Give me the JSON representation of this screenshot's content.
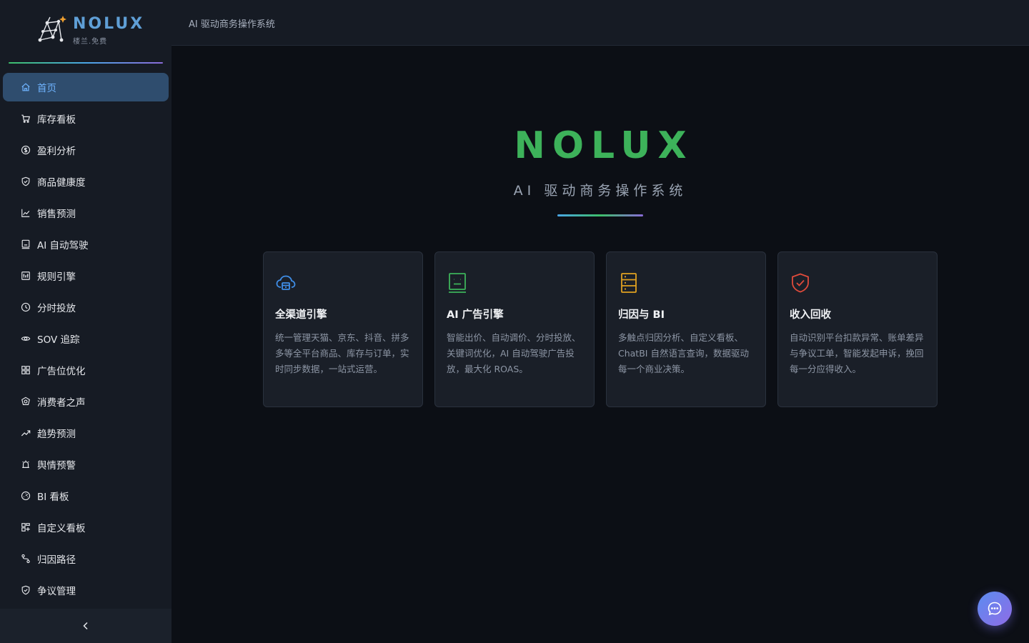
{
  "brand": {
    "name": "NOLUX",
    "subtitle": "楼兰.免费"
  },
  "topbar": {
    "title": "AI 驱动商务操作系统"
  },
  "sidebar": {
    "items": [
      {
        "label": "首页",
        "icon": "home-icon",
        "active": true
      },
      {
        "label": "库存看板",
        "icon": "cart-icon"
      },
      {
        "label": "盈利分析",
        "icon": "dollar-circle-icon"
      },
      {
        "label": "商品健康度",
        "icon": "shield-check-icon"
      },
      {
        "label": "销售预测",
        "icon": "line-chart-icon"
      },
      {
        "label": "AI 自动驾驶",
        "icon": "robot-icon"
      },
      {
        "label": "规则引擎",
        "icon": "rules-icon"
      },
      {
        "label": "分时投放",
        "icon": "clock-icon"
      },
      {
        "label": "SOV 追踪",
        "icon": "eye-icon"
      },
      {
        "label": "广告位优化",
        "icon": "grid-icon"
      },
      {
        "label": "消费者之声",
        "icon": "voice-icon"
      },
      {
        "label": "趋势预测",
        "icon": "trend-icon"
      },
      {
        "label": "舆情预警",
        "icon": "alert-bell-icon"
      },
      {
        "label": "BI 看板",
        "icon": "dashboard-icon"
      },
      {
        "label": "自定义看板",
        "icon": "custom-board-icon"
      },
      {
        "label": "归因路径",
        "icon": "path-icon"
      },
      {
        "label": "争议管理",
        "icon": "shield-icon"
      }
    ]
  },
  "hero": {
    "title": "NOLUX",
    "subtitle": "AI 驱动商务操作系统"
  },
  "cards": [
    {
      "title": "全渠道引擎",
      "desc": "统一管理天猫、京东、抖音、拼多多等全平台商品、库存与订单，实时同步数据，一站式运营。",
      "icon": "cloud-store-icon",
      "color": "#3f8ee8"
    },
    {
      "title": "AI 广告引擎",
      "desc": "智能出价、自动调价、分时投放、关键词优化，AI 自动驾驶广告投放，最大化 ROAS。",
      "icon": "robot-icon",
      "color": "#3db25a"
    },
    {
      "title": "归因与 BI",
      "desc": "多触点归因分析、自定义看板、ChatBI 自然语言查询，数据驱动每一个商业决策。",
      "icon": "server-icon",
      "color": "#e0a020"
    },
    {
      "title": "收入回收",
      "desc": "自动识别平台扣款异常、账单差异与争议工单，智能发起申诉，挽回每一分应得收入。",
      "icon": "shield-check-icon",
      "color": "#e04b3b"
    }
  ],
  "colors": {
    "accent": "#3db25a",
    "active_bg": "#2f4d6e",
    "active_text": "#6fb4ff"
  }
}
